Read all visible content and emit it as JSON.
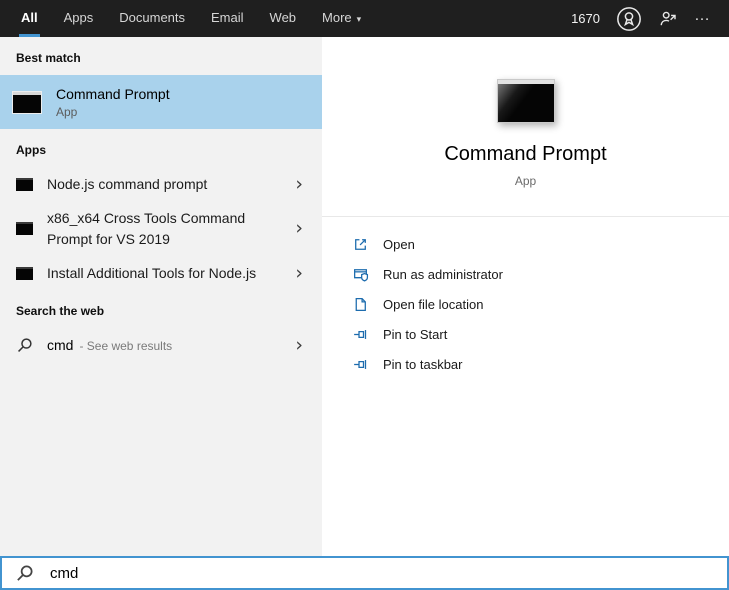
{
  "glyphs": {
    "caret": "▾",
    "ellipsis": "…",
    "chevron": "›"
  },
  "colors": {
    "accent": "#4294d0",
    "topbar_bg": "#1f1f1f",
    "selection_bg": "#a9d2ec",
    "left_panel_bg": "#f2f2f2",
    "action_icon_blue": "#1d6cae"
  },
  "topbar": {
    "tabs": [
      {
        "label": "All",
        "active": true
      },
      {
        "label": "Apps",
        "active": false
      },
      {
        "label": "Documents",
        "active": false
      },
      {
        "label": "Email",
        "active": false
      },
      {
        "label": "Web",
        "active": false
      },
      {
        "label": "More",
        "active": false,
        "icon": "chevron-down-icon"
      }
    ],
    "rewards_points": "1670",
    "icons": [
      "rewards-medal-icon",
      "feedback-icon",
      "more-options-ellipsis"
    ]
  },
  "left_panel": {
    "sections": {
      "best_match": "Best match",
      "apps": "Apps",
      "web": "Search the web"
    },
    "best_match": {
      "title": "Command Prompt",
      "subtitle": "App",
      "icon": "command-prompt-icon"
    },
    "apps": [
      {
        "label": "Node.js command prompt",
        "icon": "terminal-icon"
      },
      {
        "label": "x86_x64 Cross Tools Command Prompt for VS 2019",
        "icon": "terminal-icon"
      },
      {
        "label": "Install Additional Tools for Node.js",
        "icon": "terminal-icon"
      }
    ],
    "web_result": {
      "query": "cmd",
      "suffix": "- See web results",
      "icon": "search-icon"
    }
  },
  "preview_panel": {
    "title": "Command Prompt",
    "subtitle": "App",
    "icon": "command-prompt-icon",
    "actions": [
      {
        "label": "Open",
        "icon": "open-icon"
      },
      {
        "label": "Run as administrator",
        "icon": "admin-shield-icon"
      },
      {
        "label": "Open file location",
        "icon": "file-location-icon"
      },
      {
        "label": "Pin to Start",
        "icon": "pin-icon"
      },
      {
        "label": "Pin to taskbar",
        "icon": "pin-icon"
      }
    ]
  },
  "search_box": {
    "value": "cmd",
    "icon": "search-icon"
  }
}
